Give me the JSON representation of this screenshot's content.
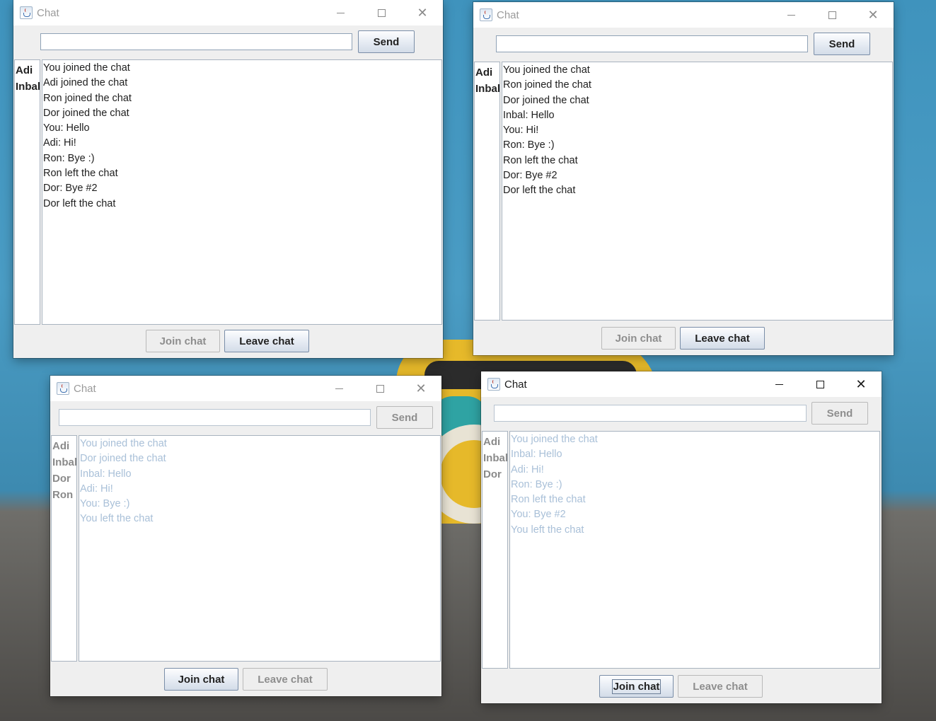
{
  "windows": [
    {
      "title": "Chat",
      "input_value": "",
      "send_label": "Send",
      "users": [
        "Adi",
        "Inbal"
      ],
      "messages": [
        "You joined the chat",
        "Adi joined the chat",
        "Ron joined the chat",
        "Dor joined the chat",
        "You: Hello",
        "Adi: Hi!",
        "Ron: Bye :)",
        "Ron left the chat",
        "Dor: Bye #2",
        "Dor left the chat"
      ],
      "join_label": "Join chat",
      "leave_label": "Leave chat"
    },
    {
      "title": "Chat",
      "input_value": "",
      "send_label": "Send",
      "users": [
        "Adi",
        "Inbal"
      ],
      "messages": [
        "You joined the chat",
        "Ron joined the chat",
        "Dor joined the chat",
        "Inbal: Hello",
        "You: Hi!",
        "Ron: Bye :)",
        "Ron left the chat",
        "Dor: Bye #2",
        "Dor left the chat"
      ],
      "join_label": "Join chat",
      "leave_label": "Leave chat"
    },
    {
      "title": "Chat",
      "input_value": "",
      "send_label": "Send",
      "users": [
        "Adi",
        "Inbal",
        "Dor",
        "Ron"
      ],
      "messages": [
        "You joined the chat",
        "Dor joined the chat",
        "Inbal: Hello",
        "Adi: Hi!",
        "You: Bye :)",
        "You left the chat"
      ],
      "join_label": "Join chat",
      "leave_label": "Leave chat"
    },
    {
      "title": "Chat",
      "input_value": "",
      "send_label": "Send",
      "users": [
        "Adi",
        "Inbal",
        "Dor"
      ],
      "messages": [
        "You joined the chat",
        "Inbal: Hello",
        "Adi: Hi!",
        "Ron: Bye :)",
        "Ron left the chat",
        "You: Bye #2",
        "You left the chat"
      ],
      "join_label": "Join chat",
      "leave_label": "Leave chat"
    }
  ]
}
